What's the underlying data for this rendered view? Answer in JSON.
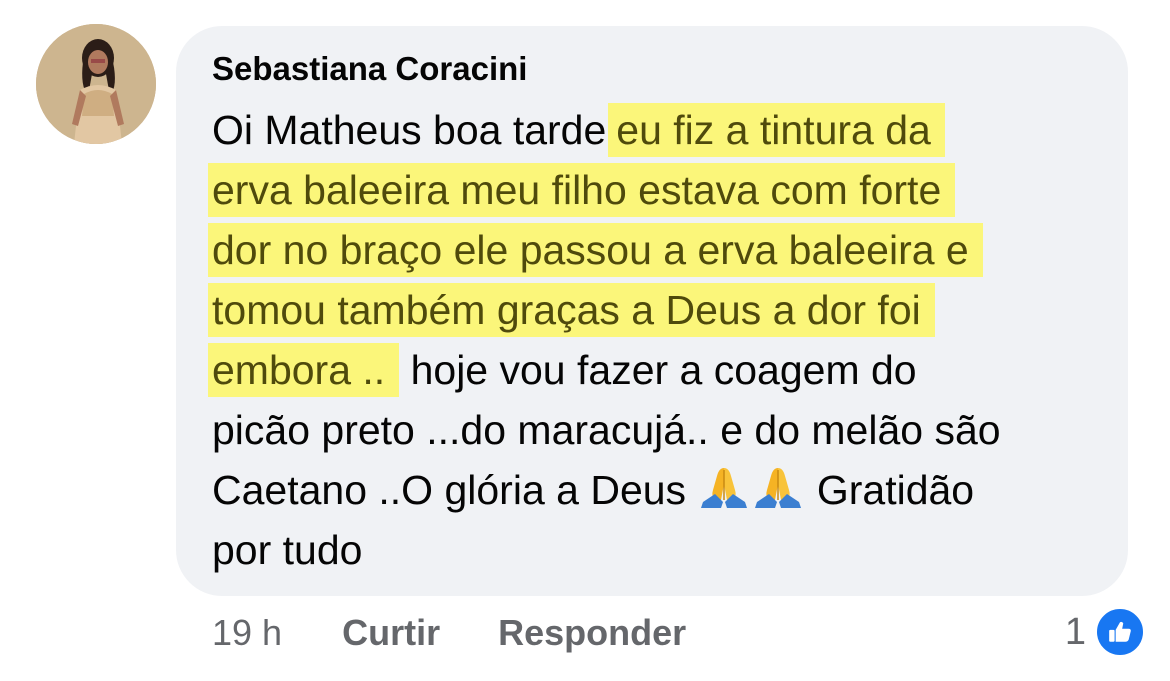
{
  "comment": {
    "author": "Sebastiana Coracini",
    "lines": [
      {
        "plain": "Oi Matheus boa tarde",
        "highlight": "eu fiz a tintura da",
        "after": ""
      },
      {
        "plain": "",
        "highlight": "erva baleeira meu filho estava com forte",
        "after": ""
      },
      {
        "plain": "",
        "highlight": "dor no braço ele passou a erva baleeira e",
        "after": ""
      },
      {
        "plain": "",
        "highlight": "tomou também graças a Deus a dor foi",
        "after": ""
      },
      {
        "plain": "",
        "highlight": "embora ..",
        "after": " hoje vou fazer a coagem  do"
      },
      {
        "plain": "picão preto ...do maracujá.. e do melão são",
        "highlight": "",
        "after": ""
      },
      {
        "plain": "Caetano ..O glória a Deus",
        "highlight": "",
        "after": "Gratidão"
      },
      {
        "plain": "por tudo",
        "highlight": "",
        "after": ""
      }
    ],
    "emoji_icons": [
      "folded-hands-icon",
      "folded-hands-icon"
    ]
  },
  "meta": {
    "time": "19 h",
    "like_label": "Curtir",
    "reply_label": "Responder"
  },
  "reactions": {
    "count": "1",
    "icon": "thumbs-up-icon"
  },
  "colors": {
    "bubble": "#f0f2f5",
    "highlight": "#fbf67a",
    "highlight_text": "#4f4a0c",
    "meta_text": "#65676b",
    "like_blue": "#1877f2"
  }
}
